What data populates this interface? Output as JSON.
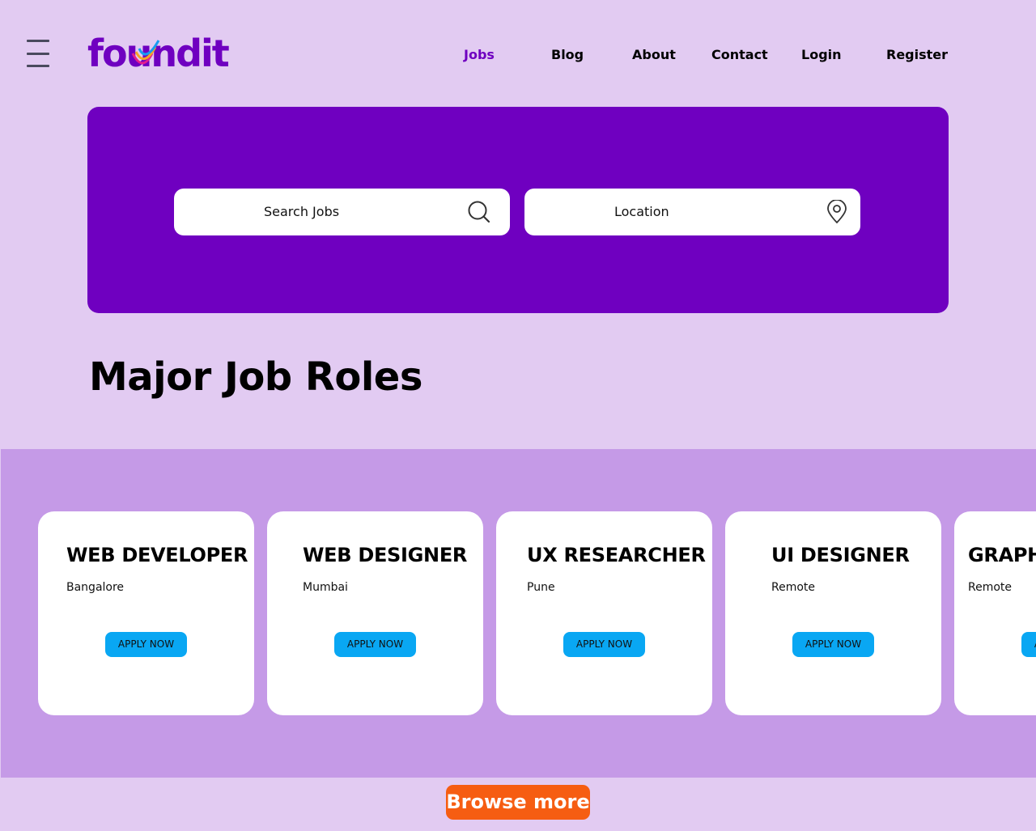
{
  "header": {
    "logo_text": "foundit",
    "nav": [
      {
        "label": "Jobs",
        "active": true
      },
      {
        "label": "Blog",
        "active": false
      },
      {
        "label": "About",
        "active": false
      },
      {
        "label": "Contact",
        "active": false
      },
      {
        "label": "Login",
        "active": false
      },
      {
        "label": "Register",
        "active": false
      }
    ]
  },
  "search": {
    "jobs_placeholder": "Search Jobs",
    "location_placeholder": "Location",
    "jobs_icon": "search-icon",
    "location_icon": "map-pin-icon"
  },
  "main": {
    "title": "Major Job Roles",
    "cards": [
      {
        "role": "WEB DEVELOPER",
        "location": "Bangalore",
        "button": "APPLY NOW"
      },
      {
        "role": "WEB DESIGNER",
        "location": "Mumbai",
        "button": "APPLY NOW"
      },
      {
        "role": "UX RESEARCHER",
        "location": "Pune",
        "button": "APPLY NOW"
      },
      {
        "role": "UI DESIGNER",
        "location": "Remote",
        "button": "APPLY NOW"
      },
      {
        "role": "GRAPHIC DESIGNER",
        "location": "Remote",
        "button": "APPLY NOW"
      }
    ],
    "browse_label": "Browse more"
  },
  "colors": {
    "page_bg": "#e2cbf2",
    "hero_bg": "#6f00c0",
    "band_bg": "#c59ae7",
    "nav_active": "#6f00c0",
    "apply_button": "#09a7f3",
    "browse_button": "#f65d12"
  }
}
